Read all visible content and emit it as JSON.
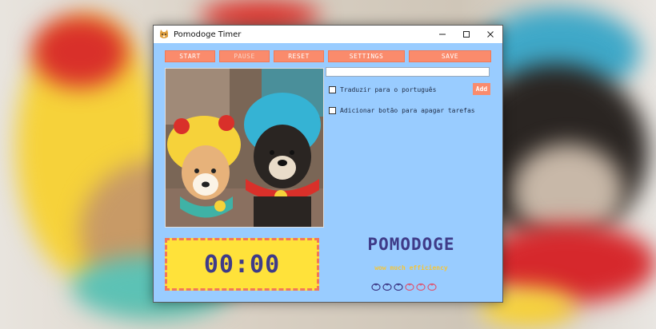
{
  "window": {
    "title": "Pomodoge Timer"
  },
  "toolbar": {
    "start_label": "START",
    "pause_label": "PAUSE",
    "reset_label": "RESET",
    "settings_label": "SETTINGS",
    "save_label": "SAVE"
  },
  "tasks": {
    "input_value": "",
    "add_label": "Add",
    "items": [
      {
        "label": "Traduzir para o português",
        "checked": false
      },
      {
        "label": "Adicionar botão para apagar tarefas",
        "checked": false
      }
    ]
  },
  "photo": {
    "icon": "dog-photo"
  },
  "timer": {
    "display": "00:00"
  },
  "branding": {
    "name": "POMODOGE",
    "tagline": "wow much efficiency"
  },
  "pomodoros": {
    "completed": 3,
    "remaining": 3,
    "total": 6
  },
  "colors": {
    "window_bg": "#99ccff",
    "button": "#fa8b6c",
    "timer_bg": "#ffe23a",
    "brand_text": "#3f3b88",
    "tagline": "#f4c53a",
    "tomato_done": "#3f3b88",
    "tomato_pending": "#d95a78"
  }
}
